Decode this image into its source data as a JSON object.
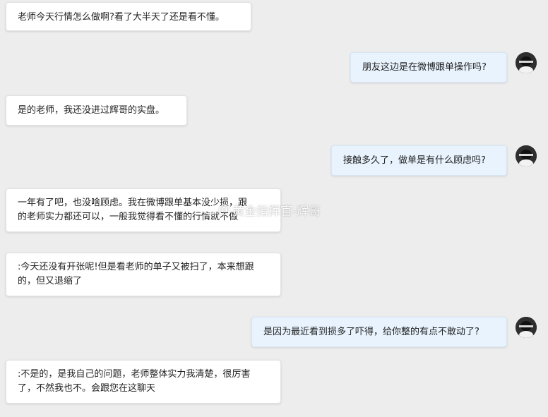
{
  "messages": [
    {
      "side": "left",
      "text": "老师今天行情怎么做啊?看了大半天了还是看不懂。"
    },
    {
      "side": "right",
      "text": "朋友这边是在微博跟单操作吗?"
    },
    {
      "side": "left",
      "text": "是的老师，我还没进过辉哥的实盘。"
    },
    {
      "side": "right",
      "text": "接触多久了，做单是有什么顾虑吗?"
    },
    {
      "side": "left",
      "text": "一年有了吧，也没啥顾虑。我在微博跟单基本没少损，跟\n的老师实力都还可以，一般我觉得看不懂的行情就不做"
    },
    {
      "side": "left",
      "text": ":今天还没有开张呢!但是看老师的单子又被扫了，本来想跟\n的，但又退缩了"
    },
    {
      "side": "right",
      "text": "是因为最近看到损多了吓得，给你整的有点不敢动了?"
    },
    {
      "side": "left",
      "text": ":不是的，是我自己的问题，老师整体实力我清楚，很厉害\n了，不然我也不。会跟您在这聊天"
    }
  ],
  "watermark": {
    "prefix": "@",
    "text": "黄金指挥官-辉哥"
  }
}
